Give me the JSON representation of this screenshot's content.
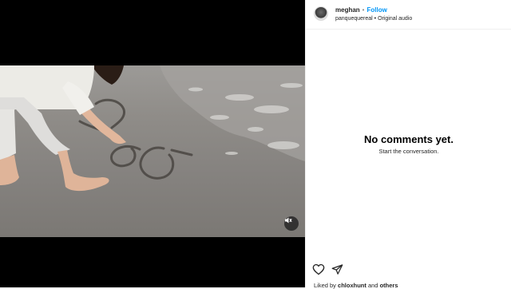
{
  "post": {
    "username": "meghan",
    "separator": "•",
    "follow_label": "Follow",
    "audio_owner": "panquequereal",
    "audio_label": "Original audio"
  },
  "comments": {
    "empty_title": "No comments yet.",
    "empty_subtitle": "Start the conversation."
  },
  "likes": {
    "prefix": "Liked by ",
    "user": "chloxhunt",
    "conjunction": " and ",
    "others": "others"
  },
  "icons": {
    "like": "heart-icon",
    "share": "paper-plane-icon",
    "mute": "speaker-muted-icon"
  },
  "colors": {
    "link_blue": "#0095f6",
    "video_background": "#000000"
  }
}
